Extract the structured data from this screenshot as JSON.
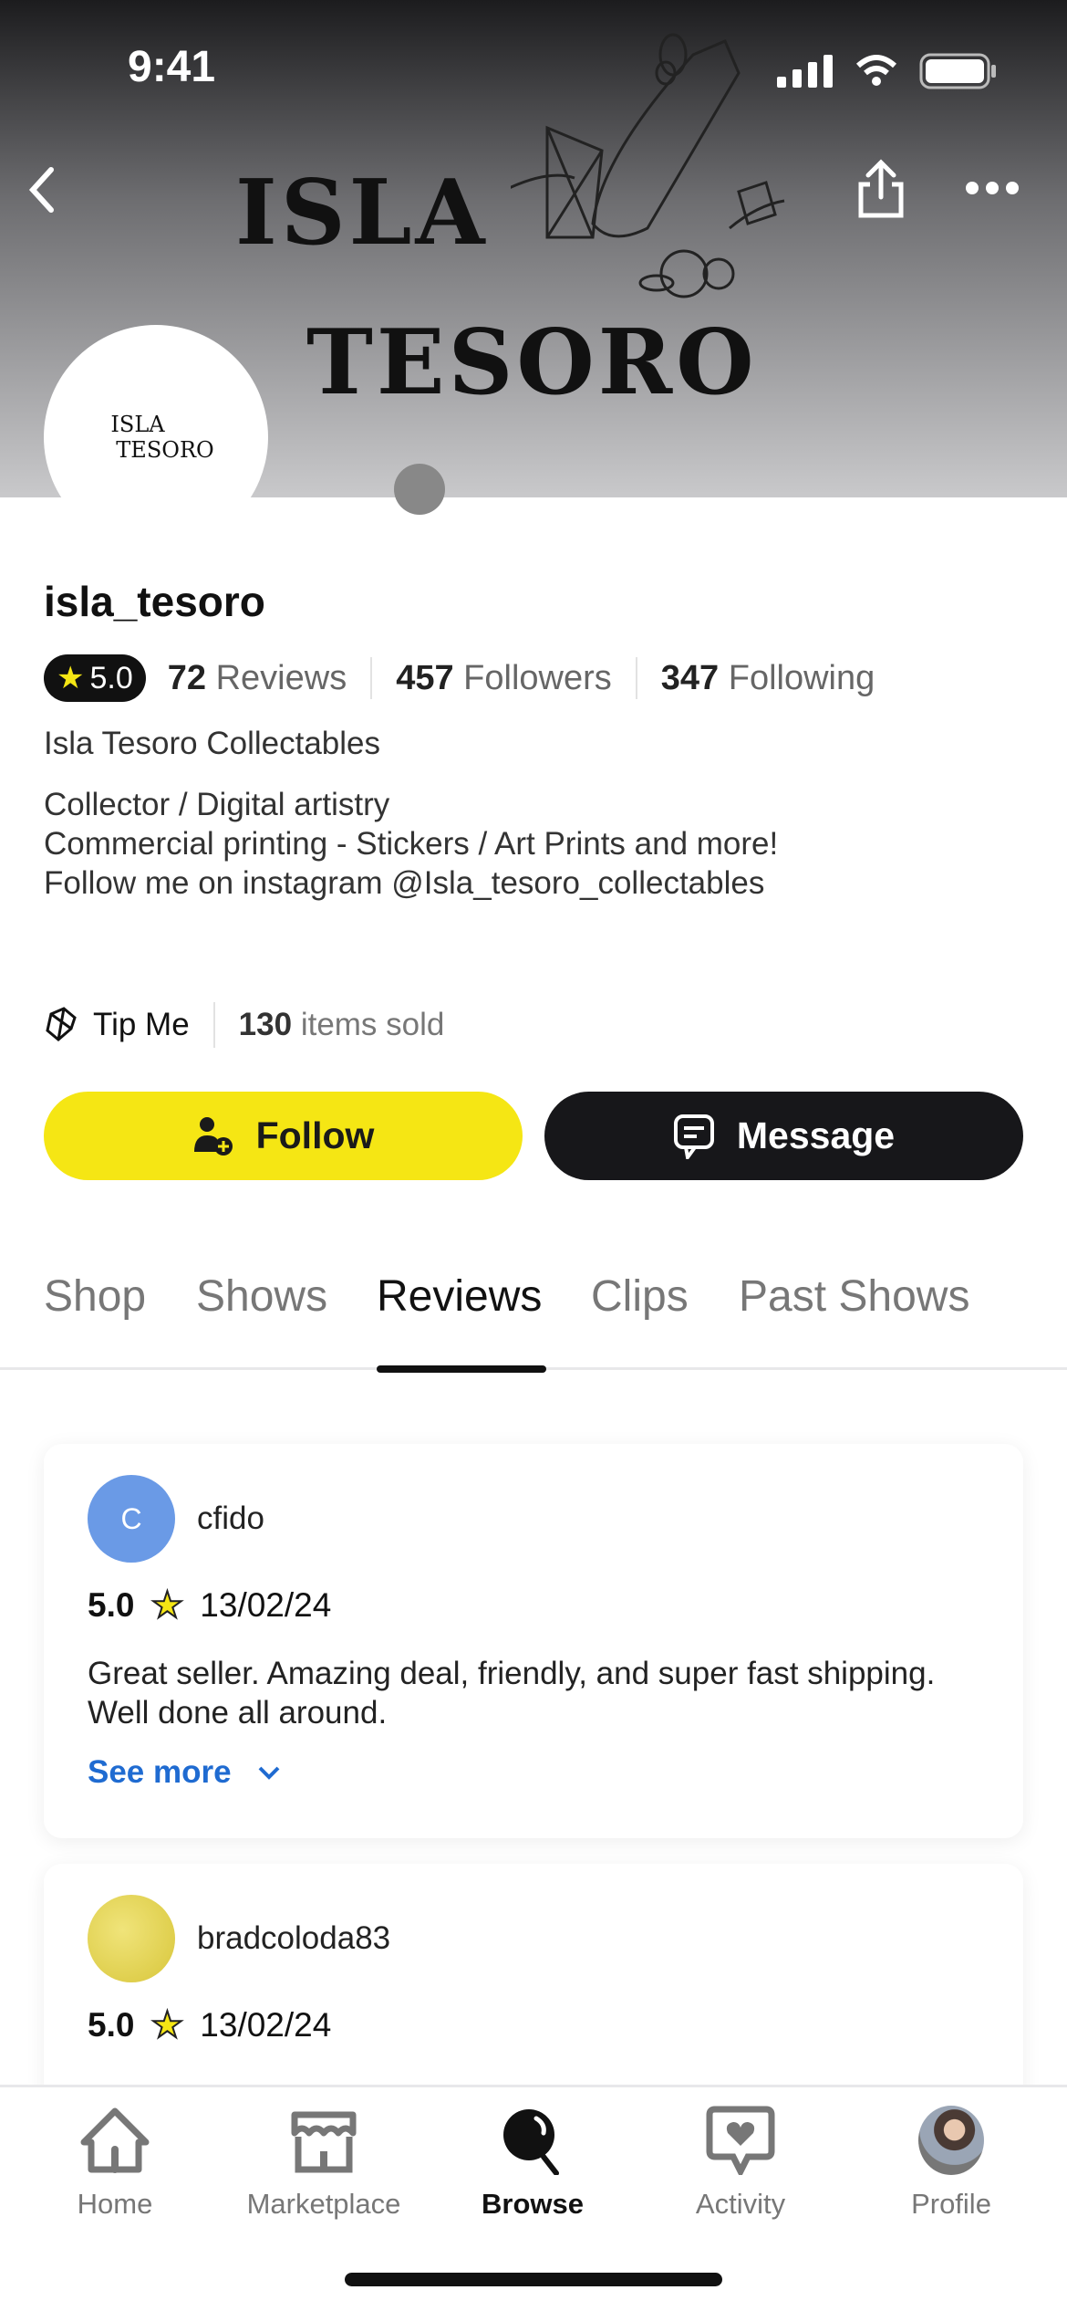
{
  "status": {
    "time": "9:41"
  },
  "banner": {
    "logo_line1": "ISLA",
    "logo_line2": "TESORO"
  },
  "avatar": {
    "logo_line1": "ISLA",
    "logo_line2": "TESORO"
  },
  "profile": {
    "username": "isla_tesoro",
    "rating": "5.0",
    "reviews_count": "72",
    "reviews_label": "Reviews",
    "followers_count": "457",
    "followers_label": "Followers",
    "following_count": "347",
    "following_label": "Following",
    "shop_name": "Isla Tesoro Collectables",
    "bio": [
      "Collector / Digital artistry",
      "Commercial printing - Stickers / Art Prints and more!",
      "Follow me on instagram @Isla_tesoro_collectables"
    ],
    "tip_label": "Tip Me",
    "items_sold_count": "130",
    "items_sold_label": "items sold"
  },
  "actions": {
    "follow": "Follow",
    "message": "Message"
  },
  "tabs": [
    {
      "label": "Shop"
    },
    {
      "label": "Shows"
    },
    {
      "label": "Reviews",
      "active": true
    },
    {
      "label": "Clips"
    },
    {
      "label": "Past Shows"
    }
  ],
  "reviews": [
    {
      "initial": "C",
      "avatar_color": "#6a9ae6",
      "user": "cfido",
      "rating": "5.0",
      "date": "13/02/24",
      "text": "Great seller. Amazing deal, friendly, and super fast shipping. Well done all around.",
      "see_more": "See more"
    },
    {
      "initial": "",
      "avatar_color": "#e8d95a",
      "user": "bradcoloda83",
      "rating": "5.0",
      "date": "13/02/24"
    }
  ],
  "nav": [
    {
      "label": "Home",
      "icon": "home-icon"
    },
    {
      "label": "Marketplace",
      "icon": "storefront-icon"
    },
    {
      "label": "Browse",
      "icon": "search-icon",
      "active": true
    },
    {
      "label": "Activity",
      "icon": "heart-bubble-icon"
    },
    {
      "label": "Profile",
      "icon": "avatar"
    }
  ],
  "colors": {
    "accent": "#f5e614",
    "dark": "#17171a",
    "link": "#1f6bd1"
  }
}
